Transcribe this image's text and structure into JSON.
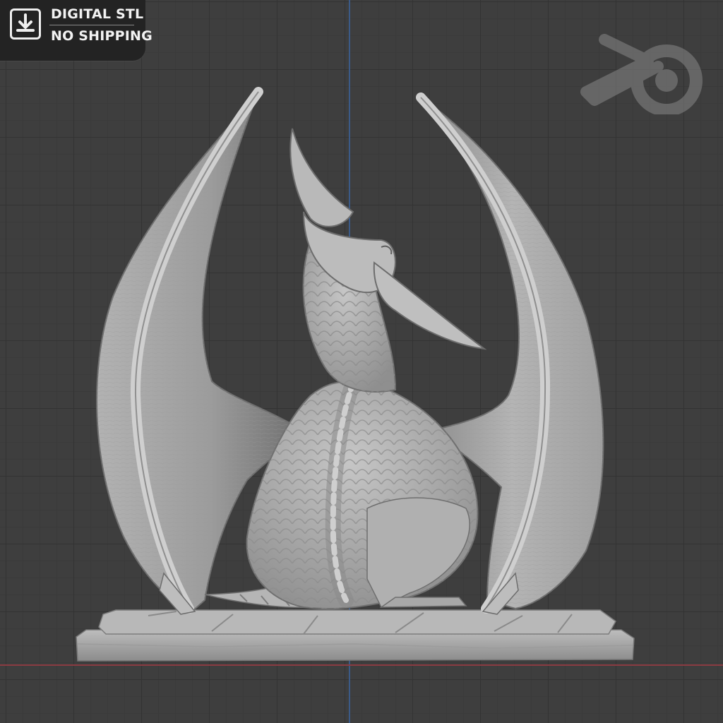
{
  "badge": {
    "line1": "DIGITAL STL",
    "line2": "NO SHIPPING",
    "icon": "download-icon"
  },
  "viewport": {
    "logo_icon": "blender-logo-icon",
    "model": "dragon-sculpture",
    "background": "#3e3e3e",
    "grid_color": "#333333",
    "x_axis_color": "#8a3b42",
    "y_axis_color": "#3b5a87",
    "model_color": "#a9a9a9"
  }
}
